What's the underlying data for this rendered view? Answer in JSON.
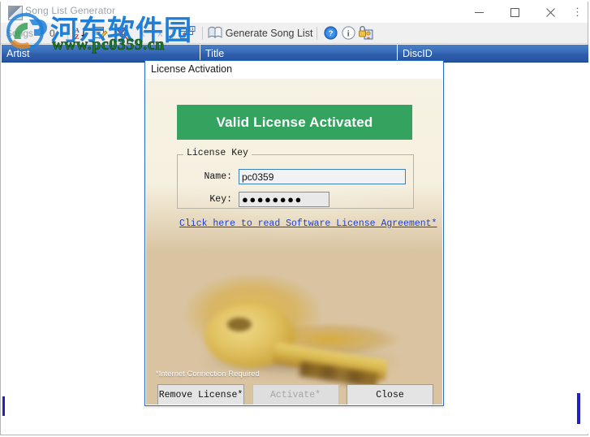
{
  "window": {
    "title": "Song List Generator",
    "icon": "app-icon",
    "controls": {
      "minimize": "minimize-icon",
      "maximize": "maximize-icon",
      "close": "close-icon",
      "menu": "more-options-icon"
    }
  },
  "toolbar": {
    "songs_label": "Songs",
    "songs_count": "0",
    "buttons": [
      {
        "name": "sort-az-icon",
        "label": "A\nZ"
      },
      {
        "name": "edit-icon",
        "label": ""
      },
      {
        "name": "filter-clear-icon",
        "label": ""
      },
      {
        "name": "delete-x-icon",
        "label": "x"
      },
      {
        "name": "remove-x-icon",
        "label": "x"
      },
      {
        "name": "dice-numbering-icon",
        "label": ""
      }
    ],
    "generate_label": "Generate Song List",
    "help_icon": "help-icon",
    "info_icon": "info-icon",
    "license_icon": "license-lock-icon"
  },
  "list": {
    "columns": [
      "Artist",
      "Title",
      "DiscID"
    ],
    "rows": []
  },
  "dialog": {
    "title": "License Activation",
    "banner_text": "Valid License Activated",
    "banner_color": "#34a35f",
    "group_legend": "License Key",
    "fields": {
      "name_label": "Name:",
      "name_value": "pc0359",
      "name_placeholder": "",
      "key_label": "Key:",
      "key_value": "●●●●●●●●",
      "key_placeholder": ""
    },
    "agreement_link": "Click here to read Software License Agreement*",
    "note": "*Internet Connection Required",
    "buttons": {
      "remove": "Remove License*",
      "activate": "Activate*",
      "close": "Close"
    }
  },
  "watermark": {
    "chinese": "河东软件园",
    "url": "www.pc0359.cn"
  }
}
